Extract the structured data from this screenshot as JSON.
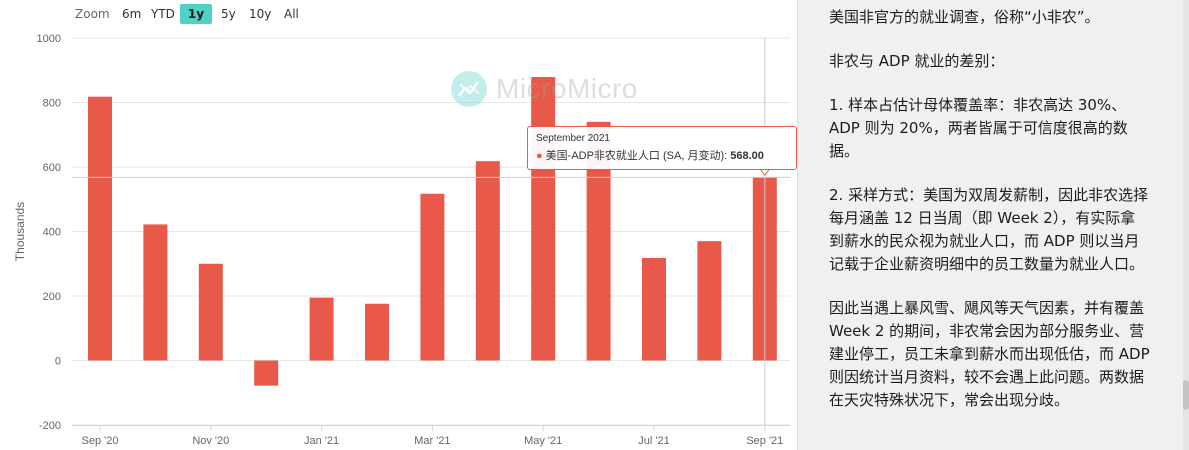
{
  "zoom": {
    "label": "Zoom",
    "buttons": [
      "6m",
      "YTD",
      "1y",
      "5y",
      "10y",
      "All"
    ],
    "active": "1y"
  },
  "watermark": {
    "text": "MicroMicro",
    "icon": "chart-logo-icon"
  },
  "chart_data": {
    "type": "bar",
    "ylabel": "Thousands",
    "ylim": [
      -200,
      1000
    ],
    "yticks": [
      -200,
      0,
      200,
      400,
      600,
      800,
      1000
    ],
    "xtick_labels": [
      "Sep '20",
      "Nov '20",
      "Jan '21",
      "Mar '21",
      "May '21",
      "Jul '21",
      "Sep '21"
    ],
    "categories": [
      "2020-09",
      "2020-10",
      "2020-11",
      "2020-12",
      "2021-01",
      "2021-02",
      "2021-03",
      "2021-04",
      "2021-05",
      "2021-06",
      "2021-07",
      "2021-08",
      "2021-09"
    ],
    "series": [
      {
        "name": "美国-ADP非农就业人口 (SA, 月变动)",
        "color": "#e8594a",
        "values": [
          818,
          422,
          300,
          -78,
          195,
          176,
          517,
          618,
          879,
          740,
          318,
          370,
          568
        ]
      }
    ],
    "gridlines": true,
    "crosshair_value": 568,
    "tooltip": {
      "date": "September 2021",
      "label": "美国-ADP非农就业人口 (SA, 月变动):",
      "value": "568.00"
    }
  },
  "text_panel": {
    "paragraphs": [
      [
        "美国非官方的就业调查，俗称“小非农”。"
      ],
      [
        "非农与 ADP 就业的差别："
      ],
      [
        "1. 样本占估计母体覆盖率：非农高达 30%、",
        "ADP 则为 20%，两者皆属于可信度很高的数",
        "据。"
      ],
      [
        "2. 采样方式：美国为双周发薪制，因此非农选择",
        "每月涵盖 12 日当周（即 Week 2），有实际拿",
        "到薪水的民众视为就业人口，而 ADP 则以当月",
        "记载于企业薪资明细中的员工数量为就业人口。"
      ],
      [
        "因此当遇上暴风雪、飓风等天气因素，并有覆盖",
        "Week 2 的期间，非农常会因为部分服务业、营",
        "建业停工，员工未拿到薪水而出现低估，而 ADP",
        "则因统计当月资料，较不会遇上此问题。两数据",
        "在天灾特殊状况下，常会出现分歧。"
      ]
    ]
  }
}
